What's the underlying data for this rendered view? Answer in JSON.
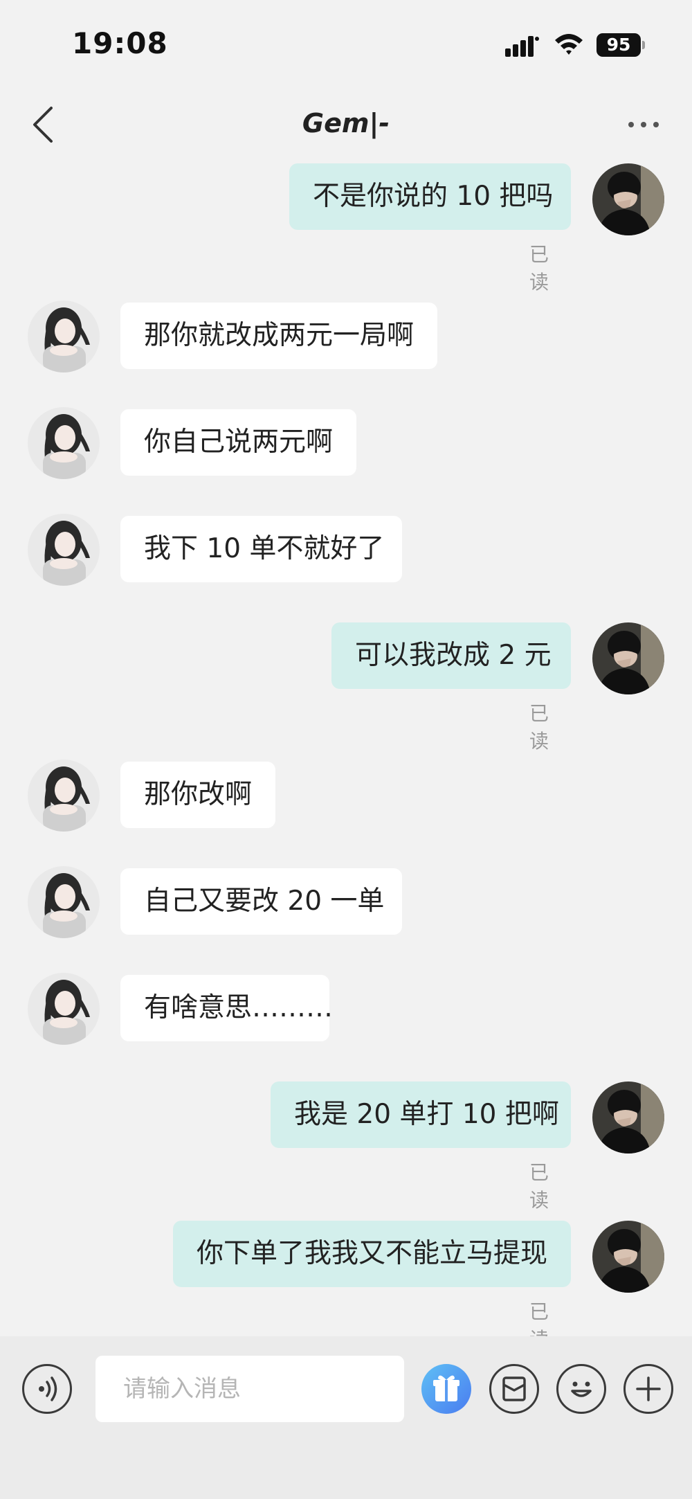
{
  "status_bar": {
    "time": "19:08",
    "battery": "95"
  },
  "nav": {
    "title": "Gem|-"
  },
  "messages": [
    {
      "side": "out",
      "text": "不是你说的 10 把吗",
      "read": "已读"
    },
    {
      "side": "in",
      "text": "那你就改成两元一局啊"
    },
    {
      "side": "in",
      "text": "你自己说两元啊"
    },
    {
      "side": "in",
      "text": "我下 10 单不就好了"
    },
    {
      "side": "out",
      "text": "可以我改成 2 元",
      "read": "已读"
    },
    {
      "side": "in",
      "text": "那你改啊"
    },
    {
      "side": "in",
      "text": "自己又要改 20 一单"
    },
    {
      "side": "in",
      "text": "有啥意思………"
    },
    {
      "side": "out",
      "text": "我是 20 单打 10 把啊",
      "read": "已读"
    },
    {
      "side": "out",
      "text": "你下单了我我又不能立马提现",
      "read": "已读"
    }
  ],
  "input": {
    "placeholder": "请输入消息"
  },
  "icons": {
    "voice": "voice-icon",
    "gift": "gift-icon",
    "wallet": "wallet-icon",
    "emoji": "emoji-icon",
    "add": "add-icon"
  },
  "colors": {
    "outgoing_bubble": "#d3efec",
    "incoming_bubble": "#ffffff",
    "background": "#f2f2f2",
    "gift_accent": "#4a9cf2"
  }
}
